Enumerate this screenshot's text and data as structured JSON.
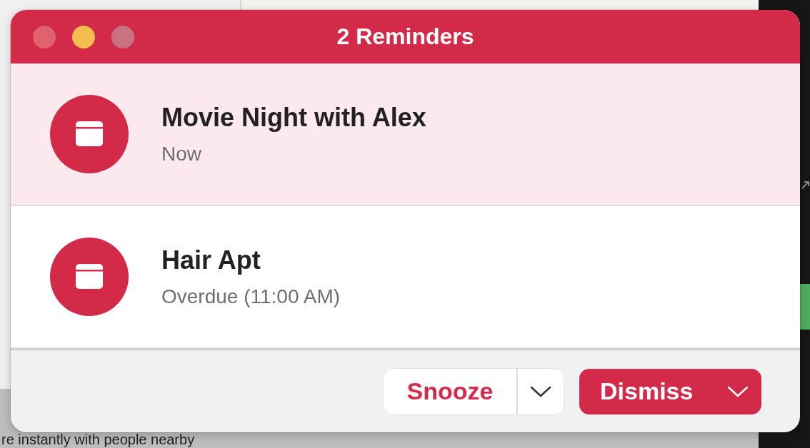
{
  "window": {
    "title": "2 Reminders"
  },
  "window_controls": [
    {
      "kind": "close"
    },
    {
      "kind": "minimize"
    },
    {
      "kind": "zoom"
    }
  ],
  "reminders": [
    {
      "title": "Movie Night with Alex",
      "subtitle": "Now",
      "selected": true
    },
    {
      "title": "Hair Apt",
      "subtitle": "Overdue (11:00 AM)",
      "selected": false
    }
  ],
  "buttons": {
    "snooze": "Snooze",
    "dismiss": "Dismiss"
  },
  "background_text": "re instantly with people nearby"
}
